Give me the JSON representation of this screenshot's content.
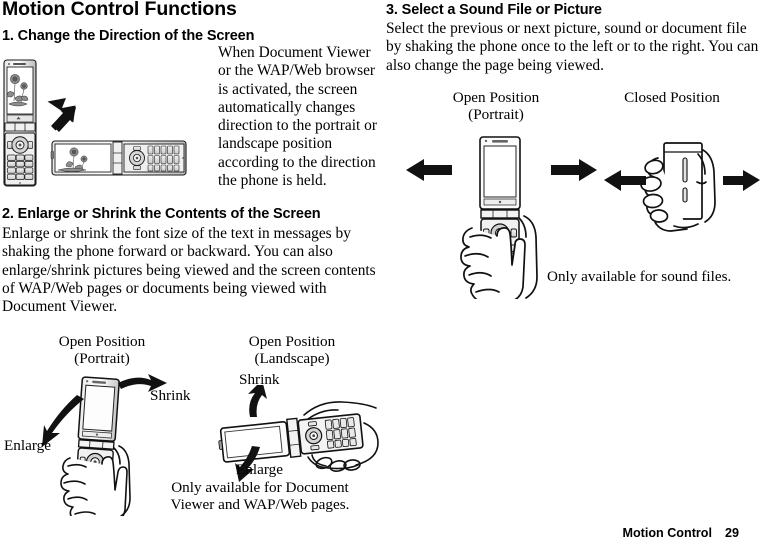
{
  "document": {
    "title": "Motion Control Functions",
    "footer": {
      "section": "Motion Control",
      "page": "29"
    }
  },
  "sections": [
    {
      "id": "change-direction",
      "heading": "1. Change the Direction of the Screen",
      "body": "When Document Viewer or the WAP/Web browser is activated, the screen automatically changes direction to the portrait or landscape position according to the direction the phone is held."
    },
    {
      "id": "enlarge-shrink",
      "heading": "2. Enlarge or Shrink the Contents of the Screen",
      "body": "Enlarge or shrink the font size of the text in messages by shaking the phone forward or backward. You can also enlarge/shrink pictures being viewed and the screen contents of WAP/Web pages or documents being viewed with Document Viewer.",
      "figure": {
        "left": {
          "caption_line1": "Open Position",
          "caption_line2": "(Portrait)",
          "label_shrink": "Shrink",
          "label_enlarge": "Enlarge"
        },
        "right": {
          "caption_line1": "Open Position",
          "caption_line2": "(Landscape)",
          "label_shrink": "Shrink",
          "label_enlarge": "Enlarge",
          "note_line1": "Only available for Document",
          "note_line2": "Viewer and WAP/Web pages."
        }
      }
    },
    {
      "id": "select-sound-picture",
      "heading": "3. Select a Sound File or Picture",
      "body": "Select the previous or next picture, sound or document file by shaking the phone once to the left or to the right. You can also change the page being viewed.",
      "figure": {
        "left": {
          "caption_line1": "Open Position",
          "caption_line2": "(Portrait)"
        },
        "right": {
          "caption_line1": "Closed Position"
        },
        "note": "Only available for sound files."
      }
    }
  ]
}
